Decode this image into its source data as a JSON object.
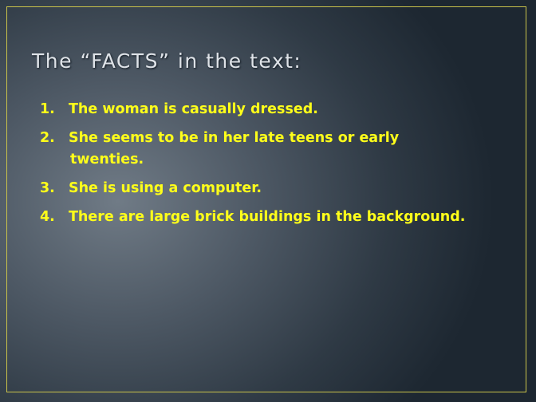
{
  "slide": {
    "title": "The “FACTS” in the text:",
    "facts": [
      {
        "number": "1.",
        "lines": [
          "The woman is casually dressed."
        ]
      },
      {
        "number": "2.",
        "lines": [
          "She seems to be in her late teens or early",
          "twenties."
        ]
      },
      {
        "number": "3.",
        "lines": [
          "She is using a computer."
        ]
      },
      {
        "number": "4.",
        "lines": [
          "There are large brick buildings in the background."
        ]
      }
    ]
  },
  "colors": {
    "title_text": "#dfe3e8",
    "list_text": "#ffff1a",
    "frame_border": "#c9c24a",
    "background_light": "#707b86",
    "background_dark": "#1d2731"
  }
}
